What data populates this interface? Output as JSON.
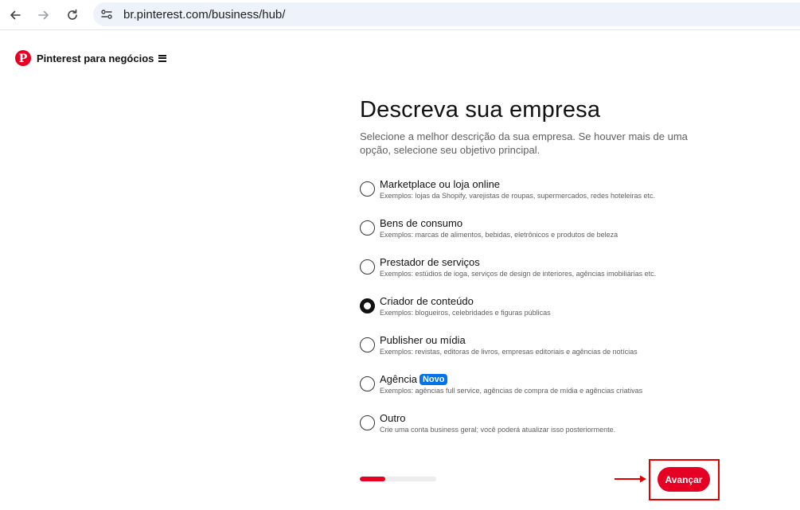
{
  "browser": {
    "url": "br.pinterest.com/business/hub/"
  },
  "brand": {
    "name": "Pinterest para negócios",
    "logo_letter": "P",
    "color": "#e60023"
  },
  "form": {
    "title": "Descreva sua empresa",
    "subtitle": "Selecione a melhor descrição da sua empresa. Se houver mais de uma opção, selecione seu objetivo principal.",
    "selected_option_index": 3,
    "options": [
      {
        "label": "Marketplace ou loja online",
        "description": "Exemplos: lojas da Shopify, varejistas de roupas, supermercados, redes hoteleiras etc.",
        "badge": "",
        "selected": false
      },
      {
        "label": "Bens de consumo",
        "description": "Exemplos: marcas de alimentos, bebidas, eletrônicos e produtos de beleza",
        "badge": "",
        "selected": false
      },
      {
        "label": "Prestador de serviços",
        "description": "Exemplos: estúdios de ioga, serviços de design de interiores, agências imobiliárias etc.",
        "badge": "",
        "selected": false
      },
      {
        "label": "Criador de conteúdo",
        "description": "Exemplos: blogueiros, celebridades e figuras públicas",
        "badge": "",
        "selected": true
      },
      {
        "label": "Publisher ou mídia",
        "description": "Exemplos: revistas, editoras de livros, empresas editoriais e agências de notícias",
        "badge": "",
        "selected": false
      },
      {
        "label": "Agência",
        "description": "Exemplos: agências full service, agências de compra de mídia e agências criativas",
        "badge": "Novo",
        "selected": false
      },
      {
        "label": "Outro",
        "description": "Crie uma conta business geral; você poderá atualizar isso posteriormente.",
        "badge": "",
        "selected": false
      }
    ],
    "progress_fraction": 0.33,
    "next_label": "Avançar"
  },
  "colors": {
    "accent": "#e60023",
    "badge": "#0074e8",
    "annotation": "#e00000"
  }
}
